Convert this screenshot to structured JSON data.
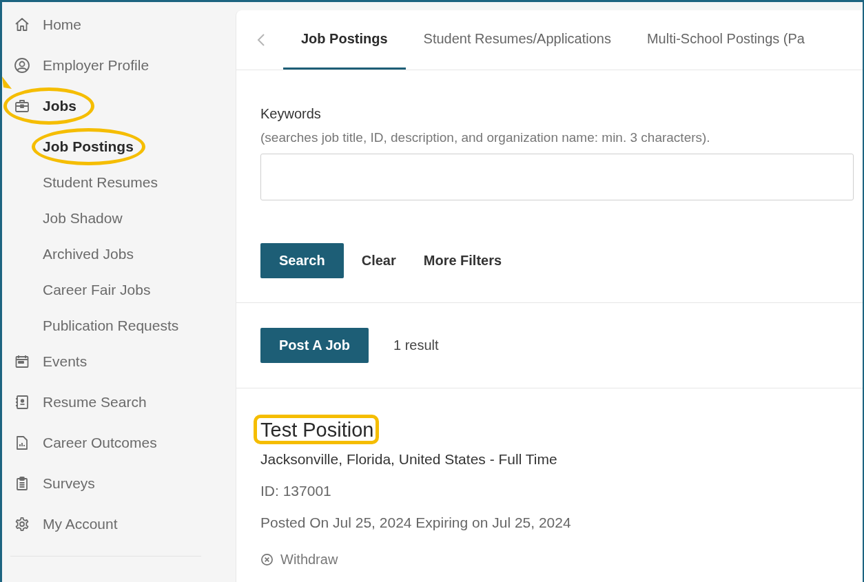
{
  "sidebar": {
    "items": [
      {
        "label": "Home",
        "selected": false,
        "highlighted": false
      },
      {
        "label": "Employer Profile",
        "selected": false,
        "highlighted": false
      },
      {
        "label": "Jobs",
        "selected": true,
        "highlighted": true,
        "children": [
          {
            "label": "Job Postings",
            "selected": true,
            "highlighted": true
          },
          {
            "label": "Student Resumes",
            "selected": false,
            "highlighted": false
          },
          {
            "label": "Job Shadow",
            "selected": false,
            "highlighted": false
          },
          {
            "label": "Archived Jobs",
            "selected": false,
            "highlighted": false
          },
          {
            "label": "Career Fair Jobs",
            "selected": false,
            "highlighted": false
          },
          {
            "label": "Publication Requests",
            "selected": false,
            "highlighted": false
          }
        ]
      },
      {
        "label": "Events",
        "selected": false,
        "highlighted": false
      },
      {
        "label": "Resume Search",
        "selected": false,
        "highlighted": false
      },
      {
        "label": "Career Outcomes",
        "selected": false,
        "highlighted": false
      },
      {
        "label": "Surveys",
        "selected": false,
        "highlighted": false
      },
      {
        "label": "My Account",
        "selected": false,
        "highlighted": false
      }
    ]
  },
  "tabs": [
    {
      "label": "Job Postings",
      "selected": true
    },
    {
      "label": "Student Resumes/Applications",
      "selected": false
    },
    {
      "label": "Multi-School Postings (Pa",
      "selected": false
    }
  ],
  "search": {
    "label": "Keywords",
    "hint": "(searches job title, ID, description, and organization name: min. 3 characters).",
    "button": "Search",
    "actions": [
      "Clear",
      "More Filters"
    ]
  },
  "results": {
    "post_button": "Post A Job",
    "count": "1 result"
  },
  "job": {
    "title": "Test Position",
    "highlighted": true,
    "location": "Jacksonville, Florida, United States - Full Time",
    "id": "ID: 137001",
    "dates": "Posted On Jul 25, 2024 Expiring on Jul 25, 2024",
    "action": "Withdraw"
  }
}
